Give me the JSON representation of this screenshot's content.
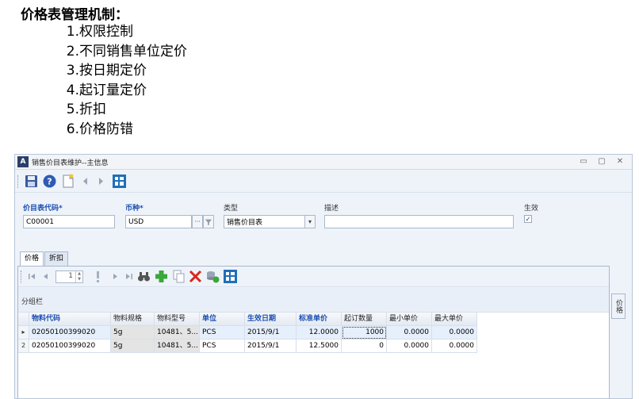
{
  "slide": {
    "title": "价格表管理机制：",
    "items": [
      {
        "num": "1.",
        "text": "权限控制"
      },
      {
        "num": "2.",
        "text": "不同销售单位定价"
      },
      {
        "num": "3.",
        "text": "按日期定价"
      },
      {
        "num": "4.",
        "text": "起订量定价"
      },
      {
        "num": "5.",
        "text": "折扣"
      },
      {
        "num": "6.",
        "text": "价格防错"
      }
    ]
  },
  "window": {
    "logo": "A",
    "title": "销售价目表维护--主信息",
    "controls": {
      "minimize": "▭",
      "maximize": "▢",
      "close": "✕"
    }
  },
  "form": {
    "code": {
      "label": "价目表代码*",
      "value": "C00001"
    },
    "currency": {
      "label": "币种*",
      "value": "USD",
      "button": "···"
    },
    "type": {
      "label": "类型",
      "value": "销售价目表",
      "dropdown": "▾"
    },
    "description": {
      "label": "描述",
      "value": ""
    },
    "effective": {
      "label": "生效",
      "checked": true,
      "mark": "✓"
    }
  },
  "tabs": [
    {
      "label": "价格",
      "active": true
    },
    {
      "label": "折扣",
      "active": false
    }
  ],
  "pager": {
    "value": "1",
    "spin_up": "▲",
    "spin_down": "▼"
  },
  "group_panel": {
    "label": "分组栏"
  },
  "side_tab": {
    "label": "价格"
  },
  "grid": {
    "columns": [
      {
        "label": "物料代码",
        "required": true
      },
      {
        "label": "物料规格",
        "required": false
      },
      {
        "label": "物料型号",
        "required": false
      },
      {
        "label": "单位",
        "required": true
      },
      {
        "label": "生效日期",
        "required": true
      },
      {
        "label": "标准单价",
        "required": true
      },
      {
        "label": "起订数量",
        "required": false
      },
      {
        "label": "最小单价",
        "required": false
      },
      {
        "label": "最大单价",
        "required": false
      }
    ],
    "rows": [
      {
        "indicator": "▸",
        "cells": [
          "02050100399020",
          "5g",
          "10481、5...",
          "PCS",
          "2015/9/1",
          "12.0000",
          "1000",
          "0.0000",
          "0.0000"
        ]
      },
      {
        "indicator": "2",
        "cells": [
          "02050100399020",
          "5g",
          "10481、5...",
          "PCS",
          "2015/9/1",
          "12.5000",
          "0",
          "0.0000",
          "0.0000"
        ]
      }
    ]
  },
  "colors": {
    "accent": "#1c4fb0",
    "selected_row": "#e6effc",
    "readonly_cell": "#e4e4e4",
    "window_bg": "#eef3fa"
  }
}
